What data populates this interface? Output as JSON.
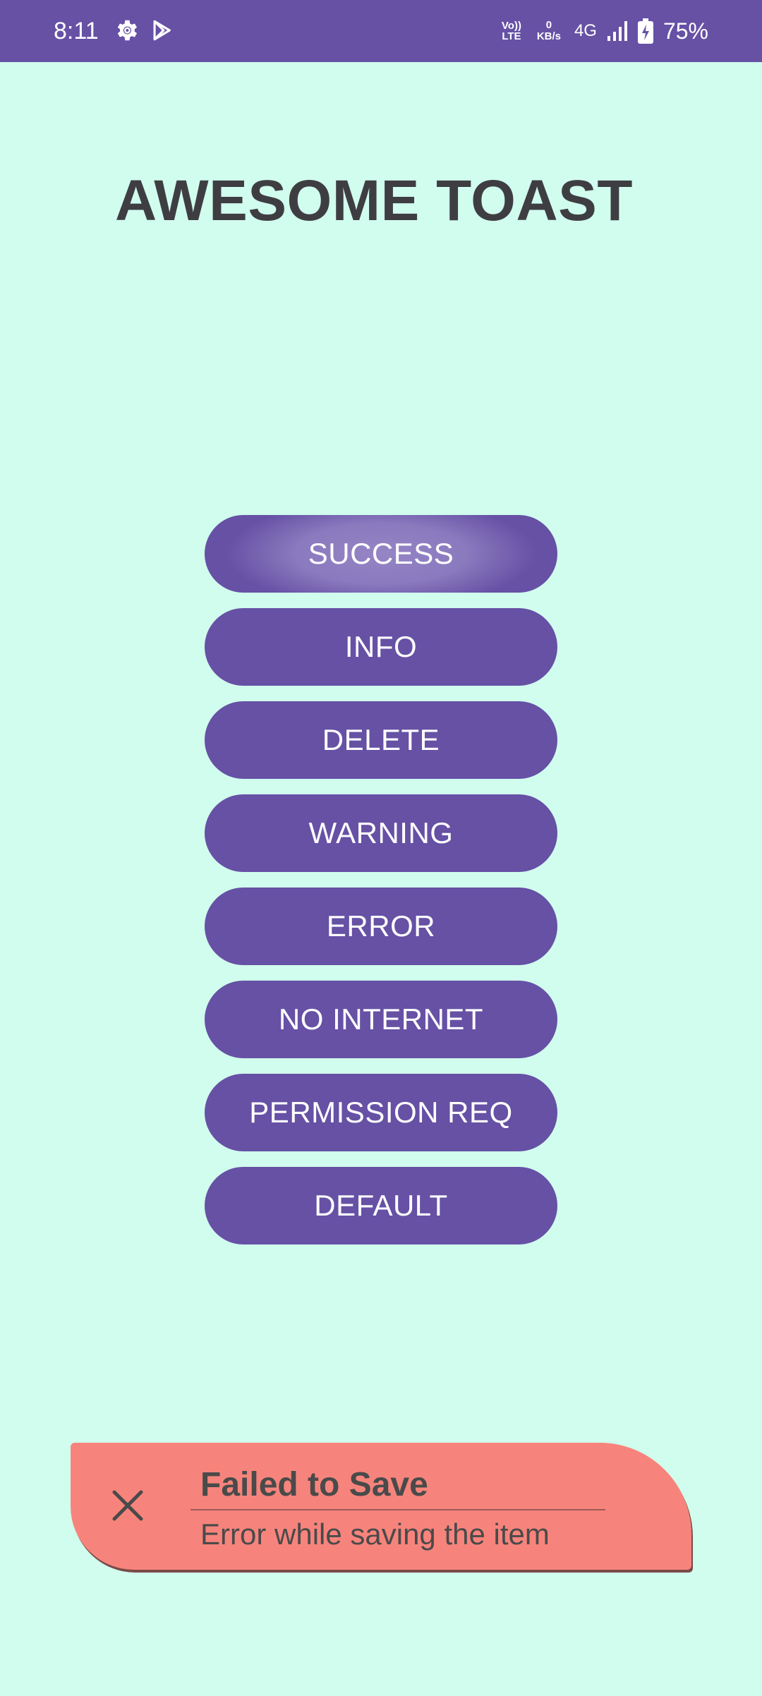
{
  "status_bar": {
    "time": "8:11",
    "volte_top": "Vo))",
    "volte_bottom": "LTE",
    "speed_value": "0",
    "speed_unit": "KB/s",
    "network": "4G",
    "battery": "75%",
    "icons": [
      "gear-icon",
      "play-store-icon",
      "signal-icon",
      "battery-charging-icon"
    ],
    "color": "#6651a5"
  },
  "app": {
    "title": "AWESOME TOAST"
  },
  "buttons": [
    {
      "label": "SUCCESS"
    },
    {
      "label": "INFO"
    },
    {
      "label": "DELETE"
    },
    {
      "label": "WARNING"
    },
    {
      "label": "ERROR"
    },
    {
      "label": "NO INTERNET"
    },
    {
      "label": "PERMISSION REQ"
    },
    {
      "label": "DEFAULT"
    }
  ],
  "toast": {
    "title": "Failed to Save",
    "message": "Error while saving the item",
    "icon": "close-icon",
    "color": "#f7847c"
  },
  "colors": {
    "background": "#d1fdee",
    "accent": "#6651a5",
    "title_text": "#3e3e42"
  }
}
